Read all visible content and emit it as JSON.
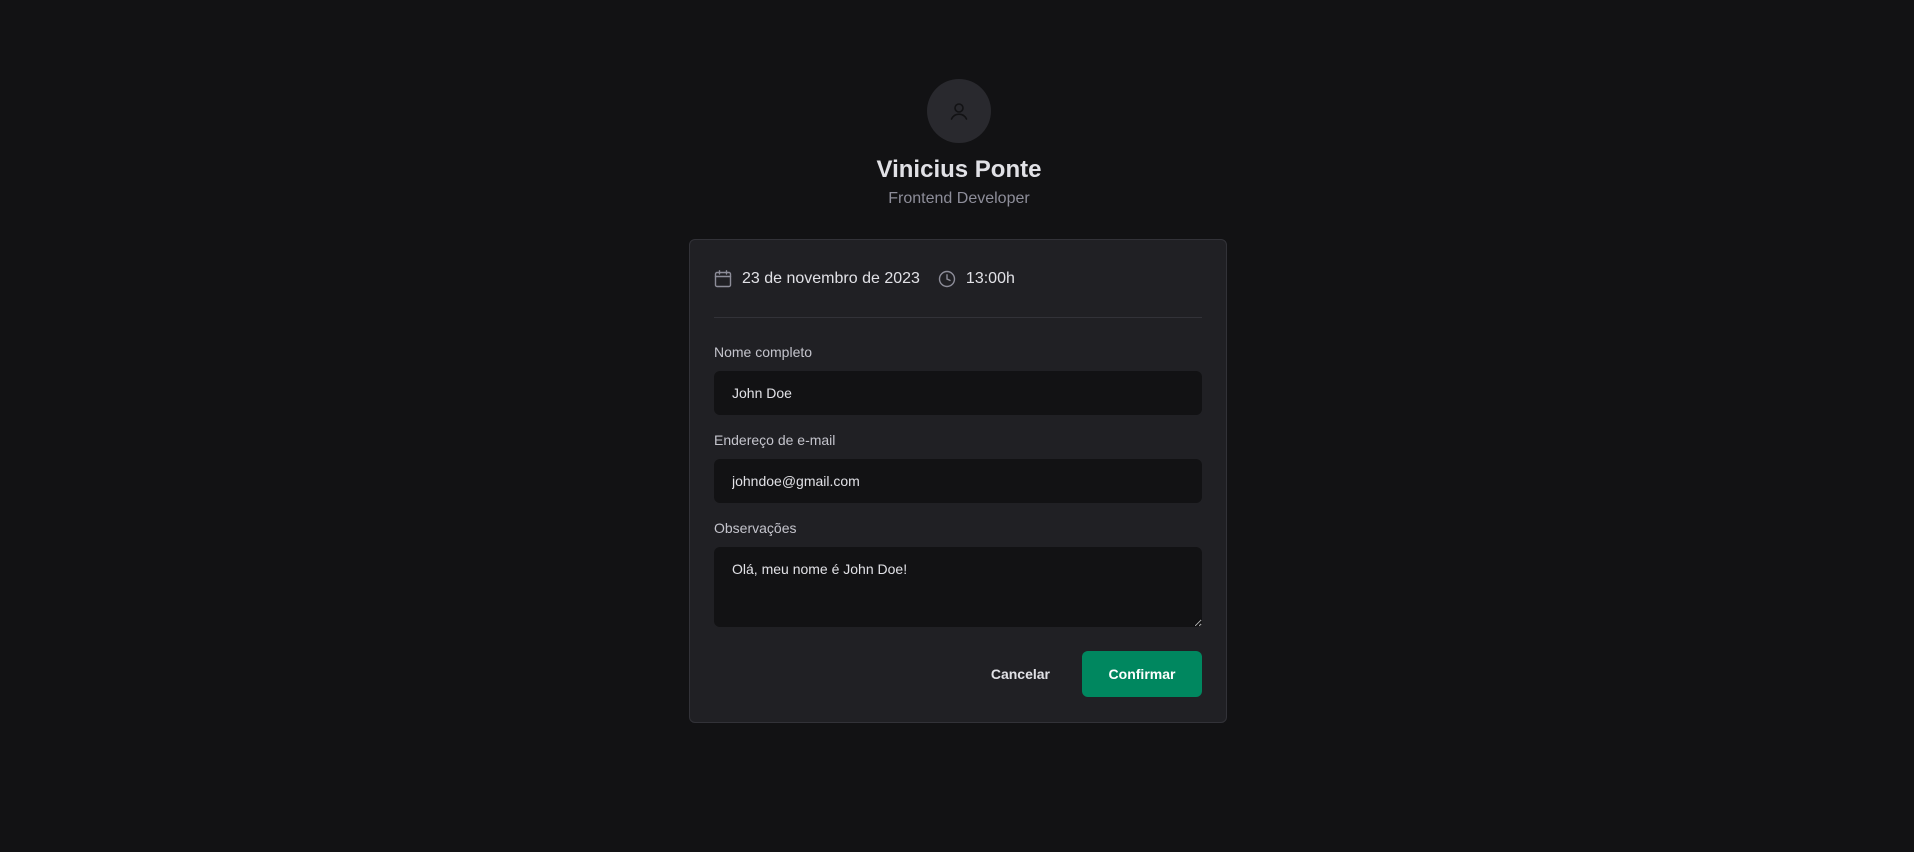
{
  "profile": {
    "avatar_icon": "user-icon",
    "name": "Vinicius Ponte",
    "role": "Frontend Developer"
  },
  "schedule": {
    "date_icon": "calendar-icon",
    "date": "23 de novembro de 2023",
    "time_icon": "clock-icon",
    "time": "13:00h"
  },
  "form": {
    "name": {
      "label": "Nome completo",
      "value": "John Doe"
    },
    "email": {
      "label": "Endereço de e-mail",
      "value": "johndoe@gmail.com"
    },
    "notes": {
      "label": "Observações",
      "value": "Olá, meu nome é John Doe!"
    }
  },
  "actions": {
    "cancel_label": "Cancelar",
    "confirm_label": "Confirmar"
  },
  "colors": {
    "background": "#121214",
    "card": "#202024",
    "input": "#121214",
    "accent": "#00875f",
    "muted_text": "#8d8d99"
  }
}
